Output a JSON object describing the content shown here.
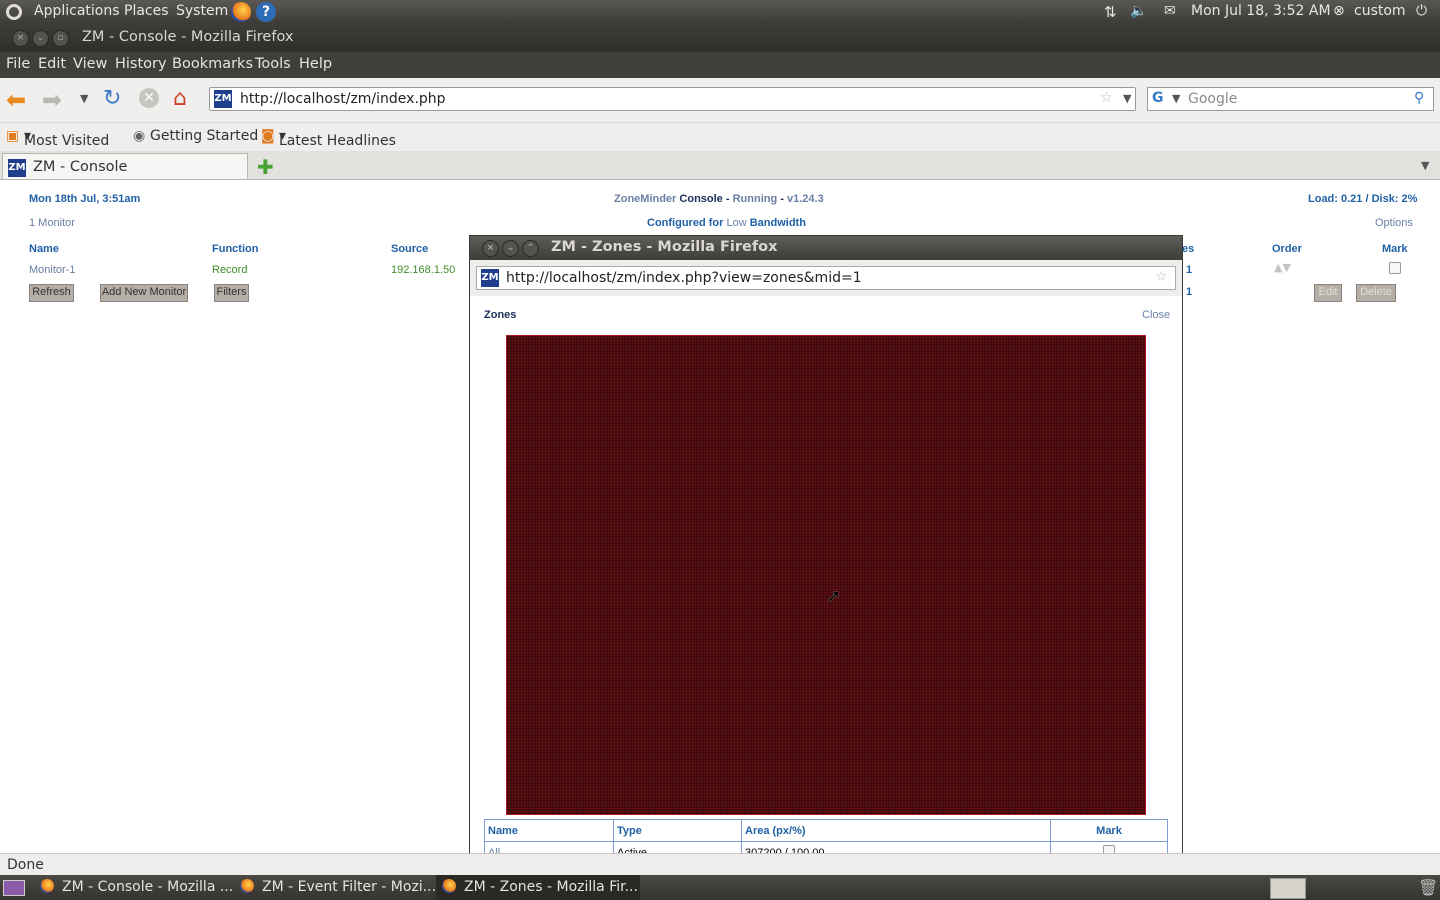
{
  "panel": {
    "applications": "Applications",
    "places": "Places",
    "system": "System",
    "clock": "Mon Jul 18,  3:52 AM",
    "user": "custom"
  },
  "window": {
    "title": "ZM - Console - Mozilla Firefox"
  },
  "menu": [
    "File",
    "Edit",
    "View",
    "History",
    "Bookmarks",
    "Tools",
    "Help"
  ],
  "nav": {
    "url": "http://localhost/zm/index.php",
    "search_placeholder": "Google"
  },
  "bookmarks": [
    "Most Visited",
    "Getting Started",
    "Latest Headlines"
  ],
  "tabs": [
    {
      "label": "ZM - Console"
    }
  ],
  "console": {
    "datetime": "Mon 18th Jul, 3:51am",
    "brand": "ZoneMinder",
    "console_word": "Console",
    "sep": "-",
    "state": "Running",
    "version": "v1.24.3",
    "load": "Load: 0.21 / Disk: 2%",
    "monitor_count": "1 Monitor",
    "configured_prefix": "Configured for",
    "bandwidth": "Low",
    "bandwidth_suffix": "Bandwidth",
    "options": "Options",
    "columns": {
      "name": "Name",
      "function": "Function",
      "source": "Source",
      "zones_partial": "es",
      "order": "Order",
      "mark": "Mark"
    },
    "row": {
      "name": "Monitor-1",
      "function": "Record",
      "source": "192.168.1.50",
      "zones": "1",
      "total": "1"
    },
    "buttons": {
      "refresh": "Refresh",
      "add": "Add New Monitor",
      "filters": "Filters",
      "edit": "Edit",
      "delete": "Delete"
    }
  },
  "popup": {
    "title": "ZM - Zones - Mozilla Firefox",
    "url": "http://localhost/zm/index.php?view=zones&mid=1",
    "heading": "Zones",
    "close": "Close",
    "table": {
      "headers": [
        "Name",
        "Type",
        "Area (px/%)",
        "Mark"
      ],
      "rows": [
        {
          "name": "All",
          "type": "Active",
          "area": "307200 / 100.00"
        }
      ]
    }
  },
  "status": "Done",
  "taskbar": [
    {
      "label": "ZM - Console - Mozilla ..."
    },
    {
      "label": "ZM - Event Filter - Mozi..."
    },
    {
      "label": "ZM - Zones - Mozilla Fir..."
    }
  ]
}
